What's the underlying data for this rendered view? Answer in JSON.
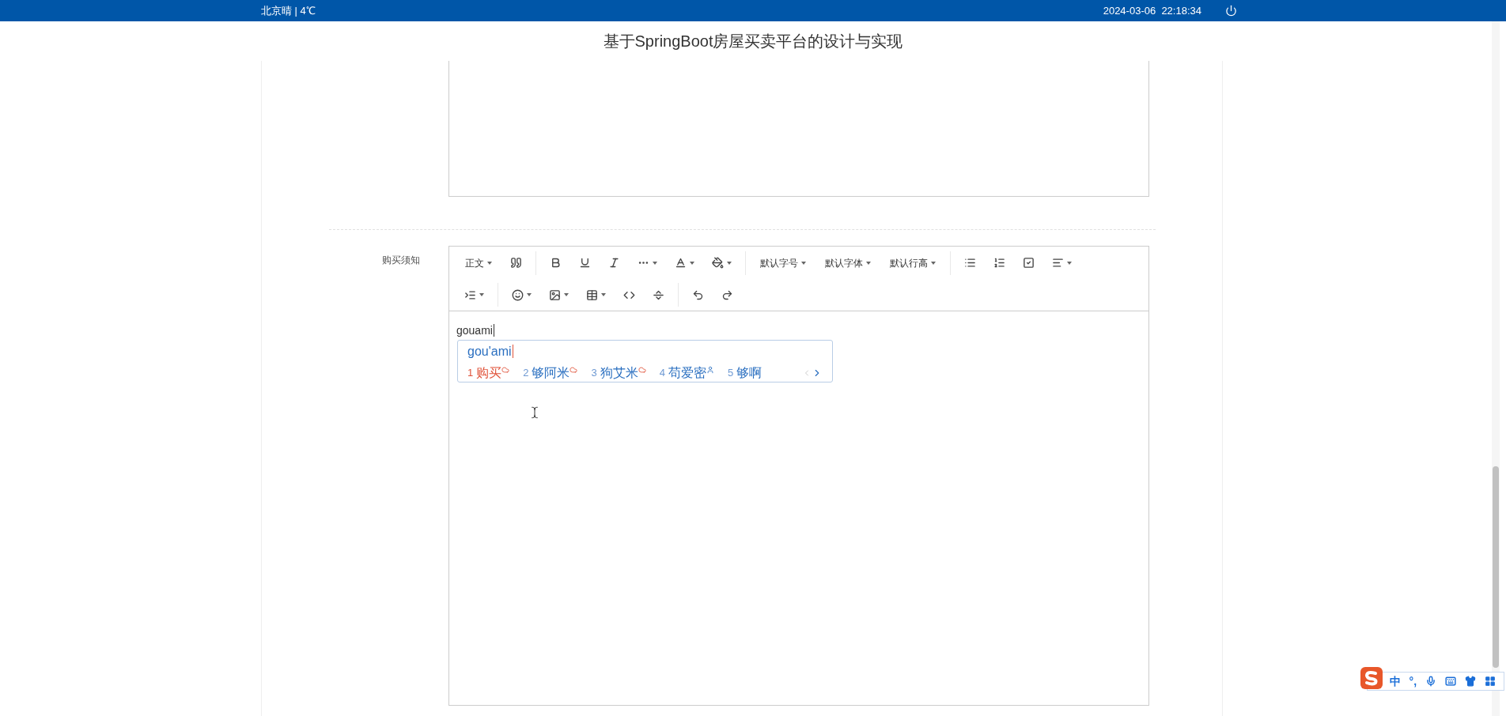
{
  "top_bar": {
    "weather": "北京晴 | 4℃",
    "datetime": "2024-03-06  22:18:34"
  },
  "header": {
    "title": "基于SpringBoot房屋买卖平台的设计与实现"
  },
  "form": {
    "field_label": "购买须知",
    "toolbar": [
      [
        {
          "kind": "dropdown",
          "label": "正文"
        },
        {
          "kind": "icon",
          "caret": false
        }
      ],
      [
        {
          "kind": "icon",
          "caret": false
        },
        {
          "kind": "icon",
          "caret": false
        },
        {
          "kind": "icon",
          "caret": false
        },
        {
          "kind": "icon",
          "caret": true
        },
        {
          "kind": "icon",
          "caret": true
        },
        {
          "kind": "icon",
          "caret": true
        }
      ],
      [
        {
          "kind": "dropdown",
          "label": "默认字号"
        },
        {
          "kind": "dropdown",
          "label": "默认字体"
        },
        {
          "kind": "dropdown",
          "label": "默认行高"
        }
      ],
      [
        {
          "kind": "icon",
          "caret": false
        },
        {
          "kind": "icon",
          "caret": false
        },
        {
          "kind": "icon",
          "caret": false
        },
        {
          "kind": "icon",
          "caret": true
        }
      ],
      [
        {
          "kind": "icon",
          "caret": true
        }
      ],
      [
        {
          "kind": "icon",
          "caret": true
        },
        {
          "kind": "icon",
          "caret": true
        },
        {
          "kind": "icon",
          "caret": true
        },
        {
          "kind": "icon",
          "caret": false
        },
        {
          "kind": "icon",
          "caret": false
        }
      ],
      [
        {
          "kind": "icon",
          "caret": false
        },
        {
          "kind": "icon",
          "caret": false
        }
      ]
    ],
    "content": "gouami"
  },
  "ime_popup": {
    "composition": "gou'ami",
    "candidates": [
      {
        "number": "1",
        "text": "购买",
        "selected": true,
        "kind": "cloud"
      },
      {
        "number": "2",
        "text": "够阿米",
        "selected": false,
        "kind": "cloud"
      },
      {
        "number": "3",
        "text": "狗艾米",
        "selected": false,
        "kind": "cloud"
      },
      {
        "number": "4",
        "text": "苟爱密",
        "selected": false,
        "kind": "user"
      },
      {
        "number": "5",
        "text": "够啊",
        "selected": false,
        "kind": "plain"
      }
    ]
  },
  "ime_bar": {
    "mode": "中",
    "punctuation": "°,"
  }
}
